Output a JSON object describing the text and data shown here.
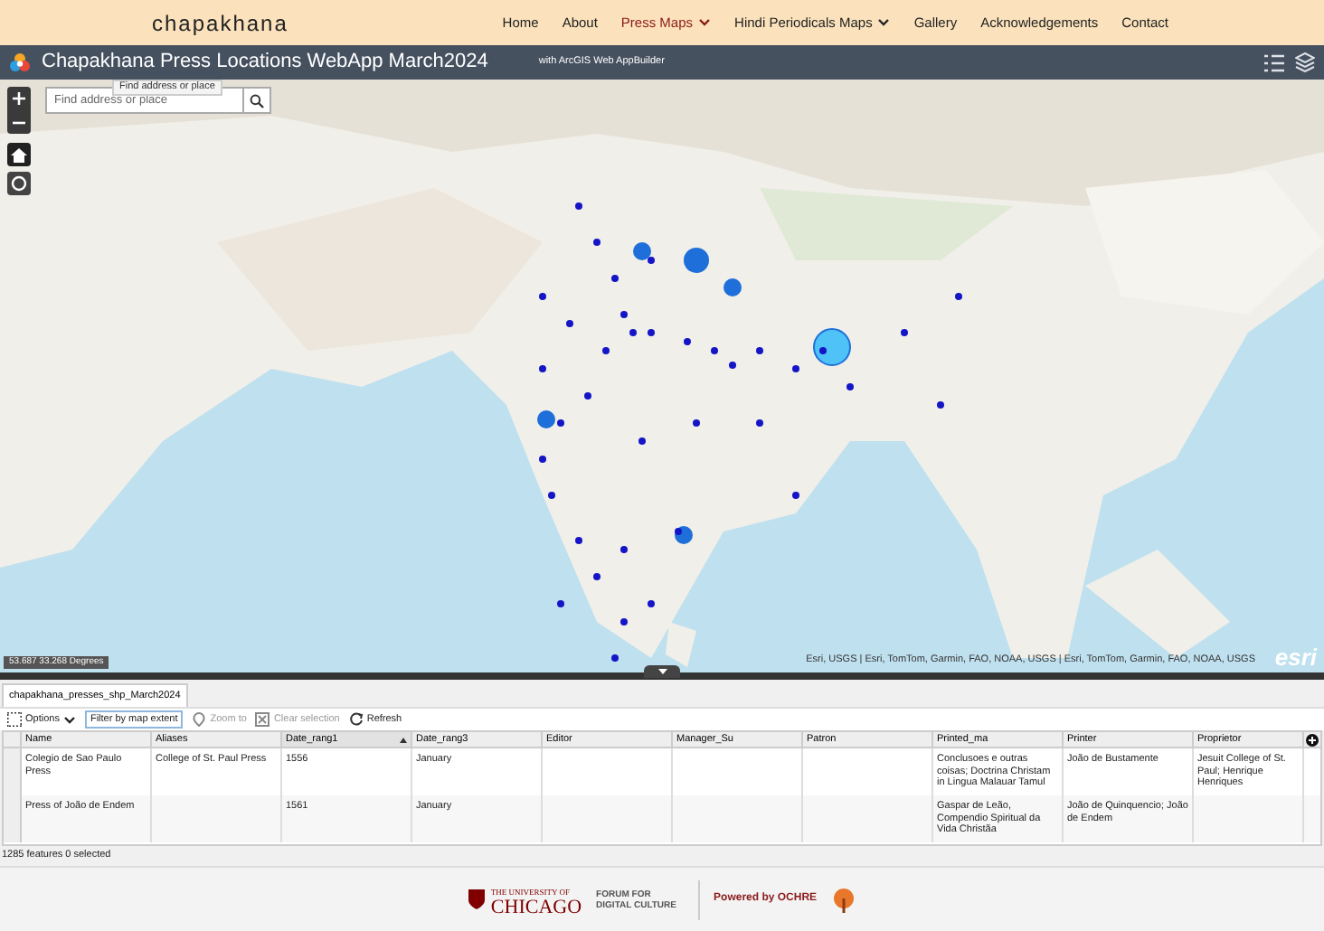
{
  "site": {
    "brand": "chapakhana",
    "nav": [
      {
        "label": "Home",
        "selected": false,
        "dropdown": false
      },
      {
        "label": "About",
        "selected": false,
        "dropdown": false
      },
      {
        "label": "Press Maps",
        "selected": true,
        "dropdown": true
      },
      {
        "label": "Hindi Periodicals Maps",
        "selected": false,
        "dropdown": true
      },
      {
        "label": "Gallery",
        "selected": false,
        "dropdown": false
      },
      {
        "label": "Acknowledgements",
        "selected": false,
        "dropdown": false
      },
      {
        "label": "Contact",
        "selected": false,
        "dropdown": false
      }
    ]
  },
  "app_header": {
    "title": "Chapakhana Press Locations WebApp March2024",
    "subtitle": "with ArcGIS Web AppBuilder"
  },
  "map": {
    "kind": "picture",
    "search": {
      "placeholder": "Find address or place",
      "tooltip": "Find address or place"
    },
    "coordinates": "53.687 33.268 Degrees",
    "attribution": "Esri, USGS | Esri, TomTom, Garmin, FAO, NOAA, USGS | Esri, TomTom, Garmin, FAO, NOAA, USGS",
    "esri_logo": "esri"
  },
  "attribute_table": {
    "tab": "chapakhana_presses_shp_March2024",
    "toolbar": [
      {
        "label": "Options",
        "kind": "menu",
        "disabled": false
      },
      {
        "label": "Filter by map extent",
        "kind": "toggle",
        "disabled": false
      },
      {
        "label": "Zoom to",
        "kind": "zoom",
        "disabled": true
      },
      {
        "label": "Clear selection",
        "kind": "clear",
        "disabled": true
      },
      {
        "label": "Refresh",
        "kind": "refresh",
        "disabled": false
      }
    ],
    "columns": [
      {
        "label": "Name",
        "sorted": false
      },
      {
        "label": "Aliases",
        "sorted": false
      },
      {
        "label": "Date_rang1",
        "sorted": true
      },
      {
        "label": "Date_rang3",
        "sorted": false
      },
      {
        "label": "Editor",
        "sorted": false
      },
      {
        "label": "Manager_Su",
        "sorted": false
      },
      {
        "label": "Patron",
        "sorted": false
      },
      {
        "label": "Printed_ma",
        "sorted": false
      },
      {
        "label": "Printer",
        "sorted": false
      },
      {
        "label": "Proprietor",
        "sorted": false
      }
    ],
    "rows": [
      [
        "Colegio de Sao Paulo Press",
        "College of St. Paul Press",
        "1556",
        "January",
        "",
        "",
        "",
        "Conclusoes e outras coisas; Doctrina Christam in Lingua Malauar Tamul",
        "João de Bustamente",
        "Jesuit College of St. Paul; Henrique Henriques"
      ],
      [
        "Press of João de Endem",
        "",
        "1561",
        "January",
        "",
        "",
        "",
        "Gaspar de Leão, Compendio Spiritual da Vida Christãa",
        "João de Quinquencio; João de Endem",
        ""
      ]
    ],
    "status": "1285 features 0 selected"
  },
  "footer": {
    "university_small": "THE UNIVERSITY OF",
    "university": "CHICAGO",
    "forum": "FORUM FOR DIGITAL CULTURE",
    "powered": "Powered by OCHRE"
  }
}
